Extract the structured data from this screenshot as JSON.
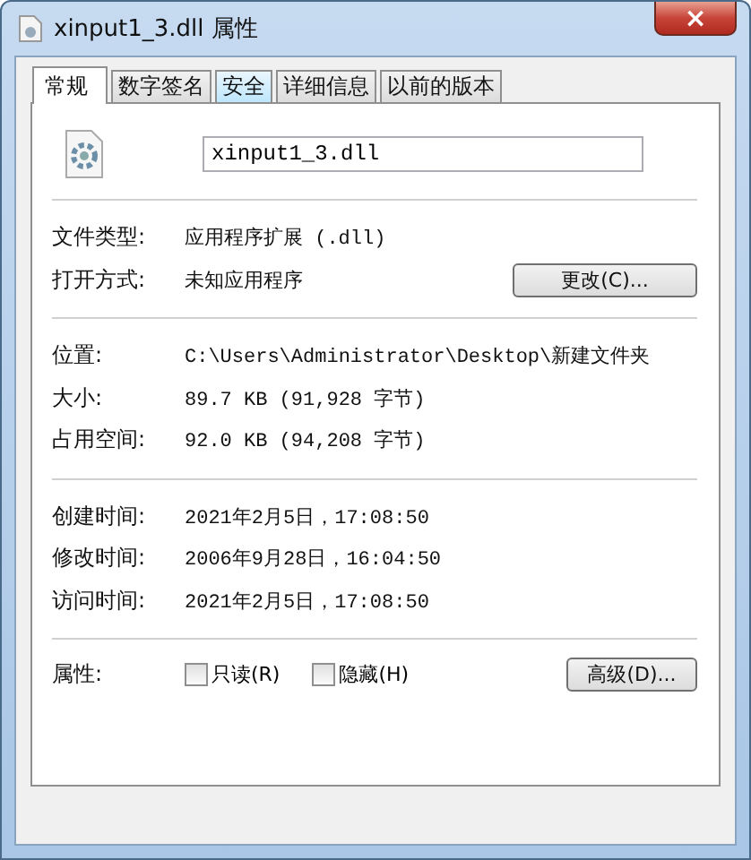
{
  "window": {
    "title": "xinput1_3.dll 属性",
    "close": "×"
  },
  "tabs": [
    {
      "label": "常规",
      "selected": true,
      "hovered": false
    },
    {
      "label": "数字签名",
      "selected": false,
      "hovered": false
    },
    {
      "label": "安全",
      "selected": false,
      "hovered": true
    },
    {
      "label": "详细信息",
      "selected": false,
      "hovered": false
    },
    {
      "label": "以前的版本",
      "selected": false,
      "hovered": false
    }
  ],
  "file_name": {
    "value": "xinput1_3.dll"
  },
  "sections": [
    [
      {
        "label": "文件类型:",
        "value": "应用程序扩展 (.dll)"
      },
      {
        "label": "打开方式:",
        "value": "未知应用程序",
        "button": "更改(C)..."
      }
    ],
    [
      {
        "label": "位置:",
        "value": "C:\\Users\\Administrator\\Desktop\\新建文件夹"
      },
      {
        "label": "大小:",
        "value": "89.7 KB (91,928 字节)"
      },
      {
        "label": "占用空间:",
        "value": "92.0 KB (94,208 字节)"
      }
    ],
    [
      {
        "label": "创建时间:",
        "value": "2021年2月5日，17:08:50"
      },
      {
        "label": "修改时间:",
        "value": "2006年9月28日，16:04:50"
      },
      {
        "label": "访问时间:",
        "value": "2021年2月5日，17:08:50"
      }
    ]
  ],
  "attributes": {
    "label": "属性:",
    "checkboxes": [
      {
        "label": "只读(R)",
        "checked": false
      },
      {
        "label": "隐藏(H)",
        "checked": false
      }
    ],
    "button": "高级(D)..."
  }
}
